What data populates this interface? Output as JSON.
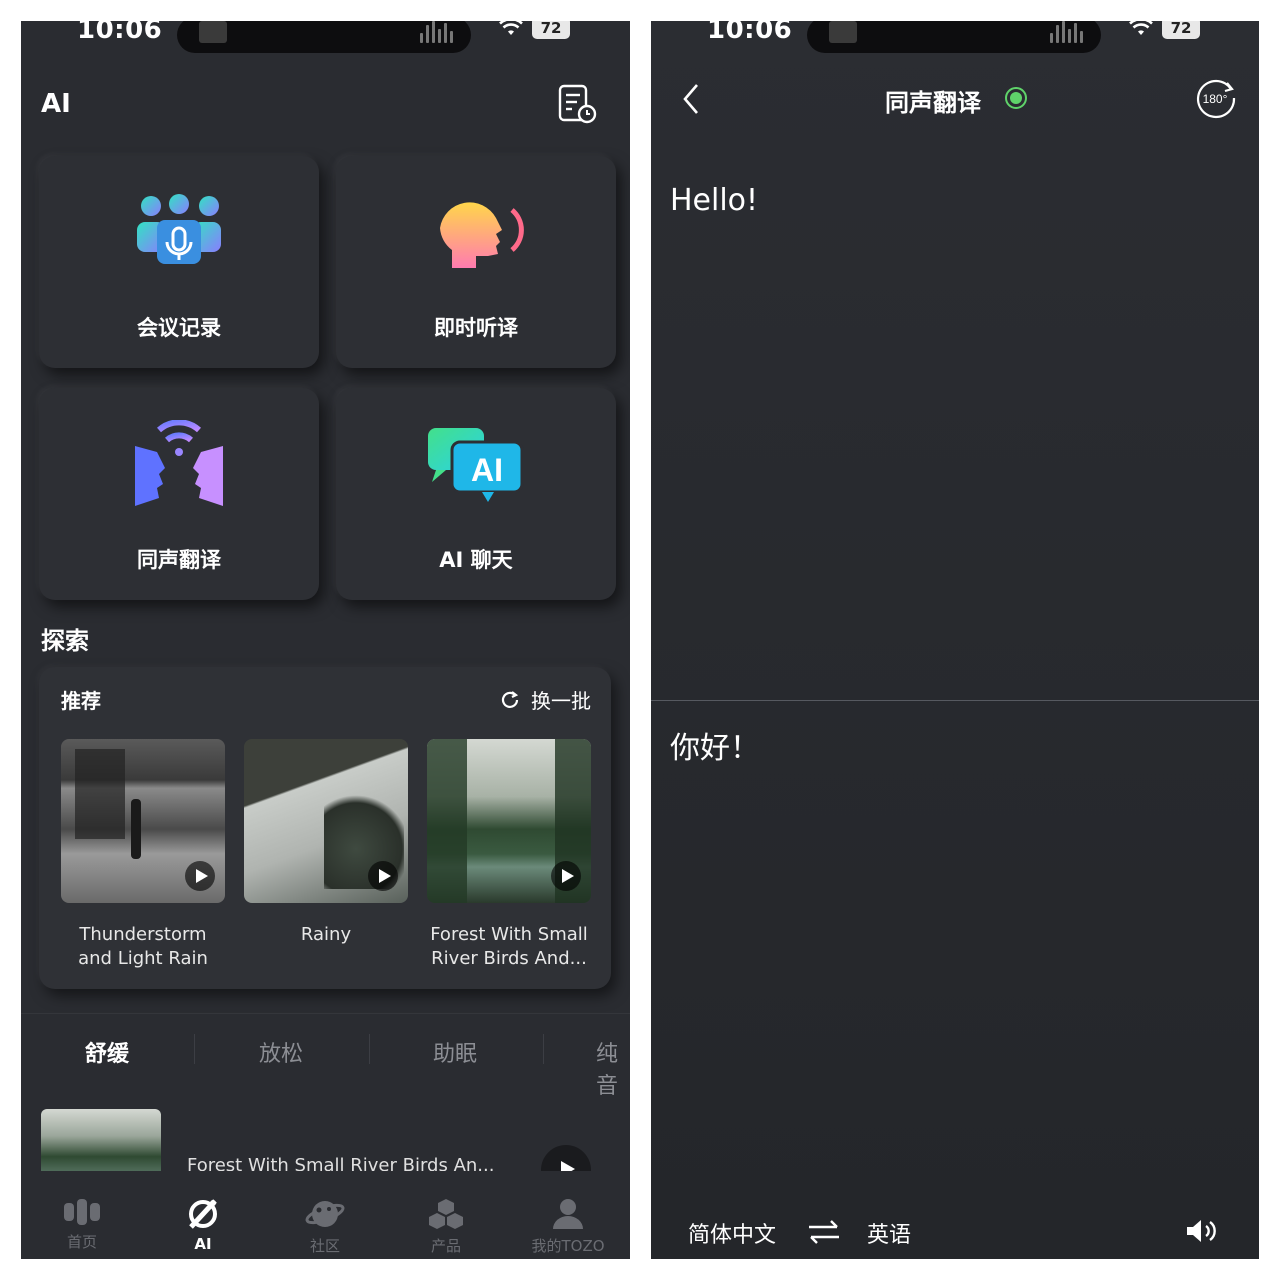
{
  "status": {
    "time": "10:06",
    "battery": "72"
  },
  "left": {
    "header": {
      "title": "AI"
    },
    "cards": [
      {
        "label": "会议记录",
        "icon": "meeting-record-icon"
      },
      {
        "label": "即时听译",
        "icon": "instant-listen-icon"
      },
      {
        "label": "同声翻译",
        "icon": "simultaneous-translation-icon"
      },
      {
        "label": "AI 聊天",
        "icon": "ai-chat-icon"
      }
    ],
    "explore": {
      "title": "探索",
      "recommend": {
        "title": "推荐",
        "refresh_label": "换一批",
        "items": [
          {
            "name": "Thunderstorm and Light Rain"
          },
          {
            "name": "Rainy"
          },
          {
            "name": "Forest With Small River Birds And..."
          }
        ]
      }
    },
    "tabs": [
      "舒缓",
      "放松",
      "助眠",
      "纯音"
    ],
    "track": {
      "name": "Forest With Small River Birds An..."
    },
    "nav": [
      {
        "label": "首页",
        "icon": "home-icon"
      },
      {
        "label": "AI",
        "icon": "ai-icon"
      },
      {
        "label": "社区",
        "icon": "community-icon"
      },
      {
        "label": "产品",
        "icon": "products-icon"
      },
      {
        "label": "我的TOZO",
        "icon": "profile-icon"
      }
    ]
  },
  "right": {
    "title": "同声翻译",
    "rotate_label": "180°",
    "source_text": "Hello!",
    "target_text": "你好！",
    "source_lang": "简体中文",
    "target_lang": "英语"
  },
  "colors": {
    "background": "#2a2c31",
    "live_green": "#5fd36a",
    "accent_gradient": [
      "#34e0c0",
      "#7a7cff"
    ]
  }
}
